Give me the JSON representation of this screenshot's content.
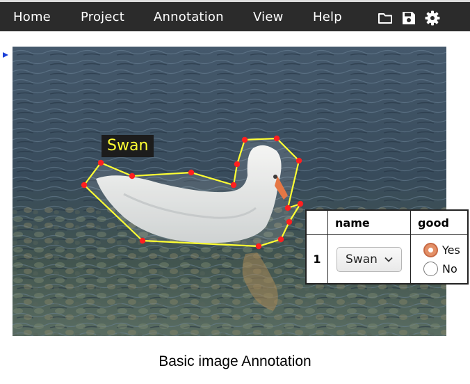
{
  "menu": {
    "items": [
      {
        "label": "Home"
      },
      {
        "label": "Project"
      },
      {
        "label": "Annotation"
      },
      {
        "label": "View"
      },
      {
        "label": "Help"
      }
    ],
    "tools": [
      "folder-icon",
      "save-icon",
      "gear-icon"
    ]
  },
  "canvas": {
    "image": "swan-on-water",
    "region": {
      "label": "Swan",
      "shape": "polygon",
      "stroke_color": "#ffff33",
      "vertex_color": "#ff2020"
    }
  },
  "attributes": {
    "headers": [
      "",
      "name",
      "good"
    ],
    "row": {
      "index": "1",
      "name_value": "Swan",
      "good_options": [
        {
          "label": "Yes",
          "checked": true
        },
        {
          "label": "No",
          "checked": false
        }
      ]
    },
    "accent_color": "#e38f66"
  },
  "caption": "Basic image Annotation"
}
